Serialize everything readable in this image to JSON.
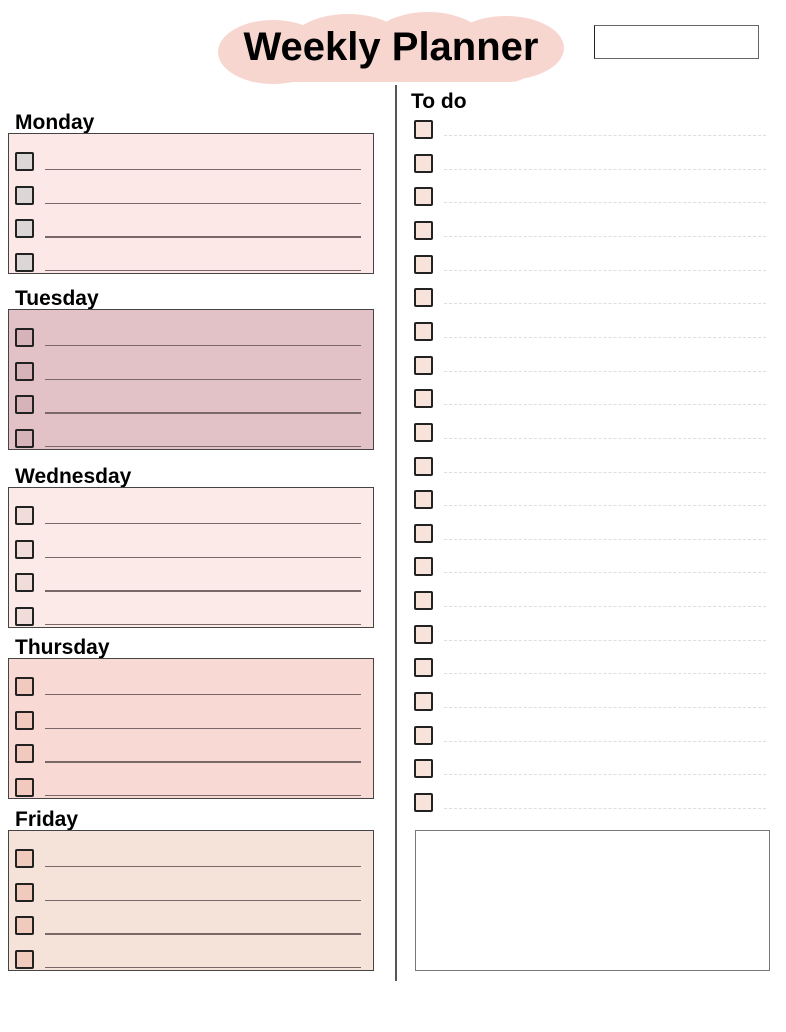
{
  "header": {
    "title": "Weekly Planner",
    "date_field_value": ""
  },
  "colors": {
    "title_highlight": "#f7d6d0",
    "monday": "#fce8e6",
    "tuesday": "#e2c2c7",
    "wednesday": "#fceae8",
    "thursday": "#f8d9d4",
    "friday": "#f5e3da",
    "checkbox_gray": "#dcd7d6",
    "checkbox_pink": "#f0d0c8"
  },
  "days": [
    {
      "label": "Monday",
      "tasks": [
        "",
        "",
        "",
        ""
      ]
    },
    {
      "label": "Tuesday",
      "tasks": [
        "",
        "",
        "",
        ""
      ]
    },
    {
      "label": "Wednesday",
      "tasks": [
        "",
        "",
        "",
        ""
      ]
    },
    {
      "label": "Thursday",
      "tasks": [
        "",
        "",
        "",
        ""
      ]
    },
    {
      "label": "Friday",
      "tasks": [
        "",
        "",
        "",
        ""
      ]
    }
  ],
  "todo": {
    "label": "To do",
    "items": [
      "",
      "",
      "",
      "",
      "",
      "",
      "",
      "",
      "",
      "",
      "",
      "",
      "",
      "",
      "",
      "",
      "",
      "",
      "",
      "",
      ""
    ]
  },
  "notes": {
    "value": ""
  }
}
